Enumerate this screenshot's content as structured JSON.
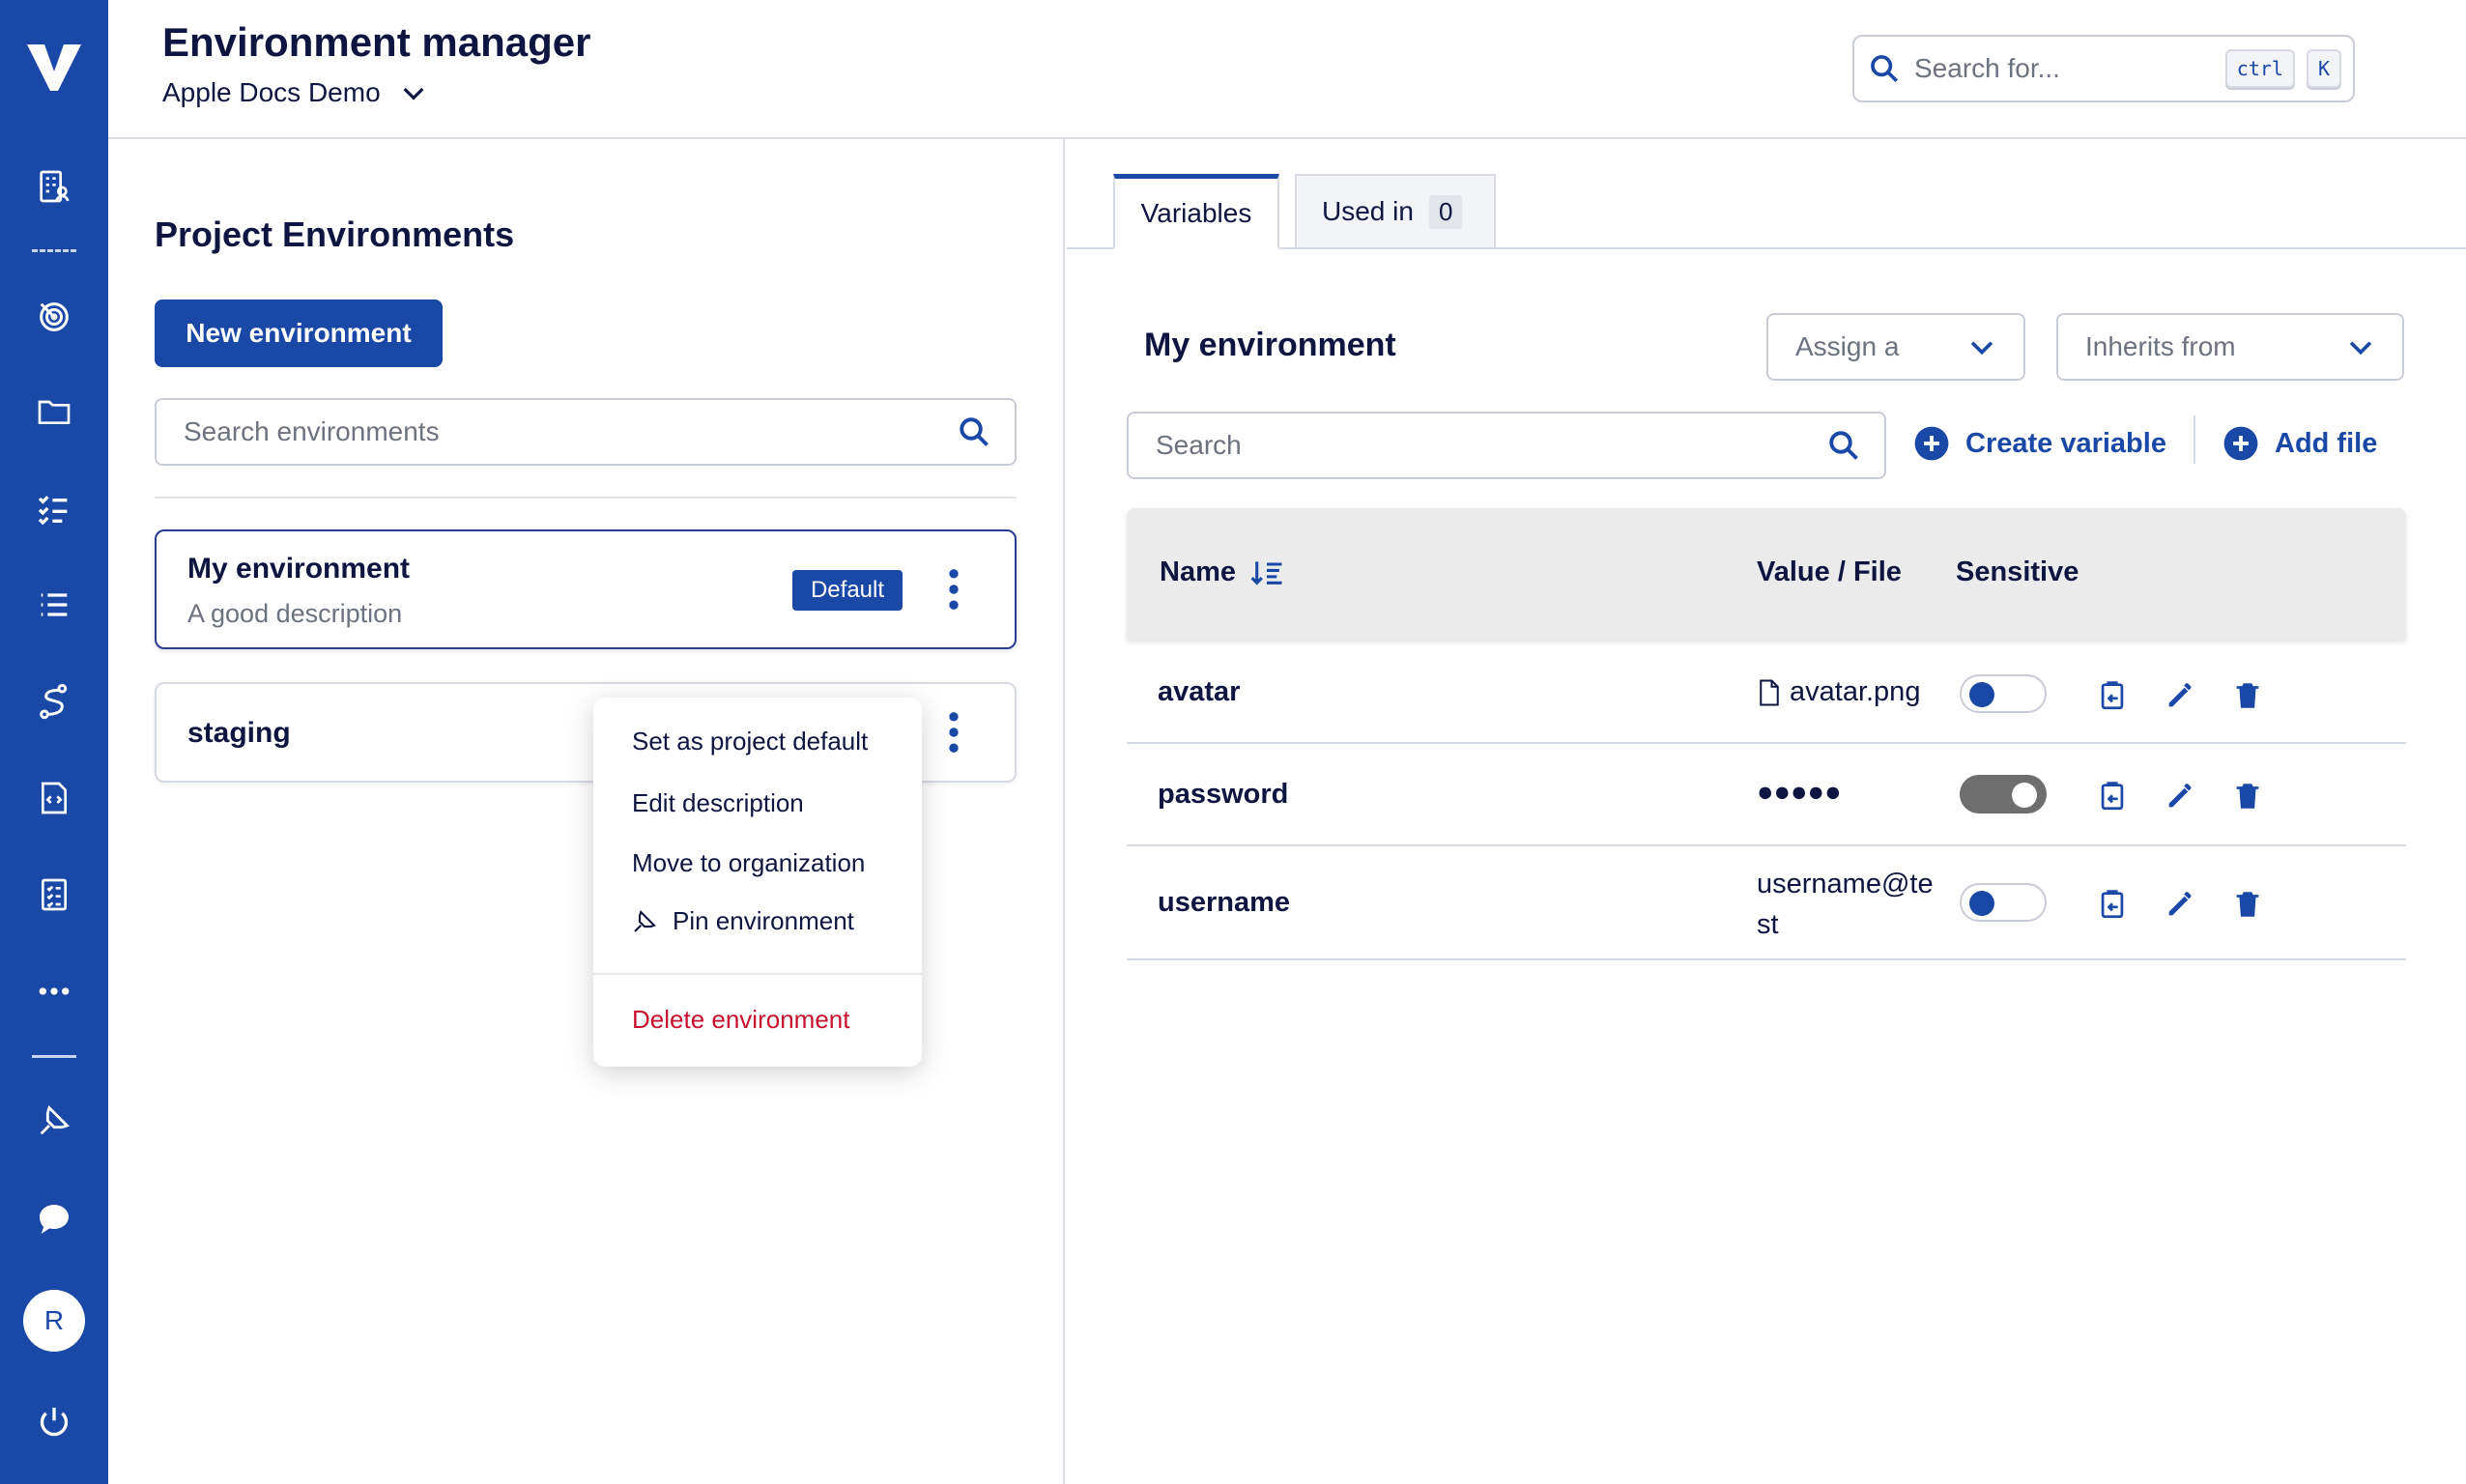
{
  "header": {
    "title": "Environment manager",
    "project_name": "Apple Docs Demo",
    "search_placeholder": "Search for...",
    "shortcut_keys": [
      "ctrl",
      "K"
    ]
  },
  "sidebar": {
    "items": [
      "logo-icon",
      "apps-icon",
      "target-icon",
      "folder-icon",
      "checklist-icon",
      "list-icon",
      "route-icon",
      "code-file-icon",
      "test-list-icon",
      "more-icon",
      "pin-icon",
      "chat-icon",
      "power-icon"
    ],
    "avatar_initial": "R",
    "accent": "#1a48a6"
  },
  "left_panel": {
    "title": "Project Environments",
    "new_button": "New environment",
    "search_placeholder": "Search environments",
    "environments": [
      {
        "name": "My environment",
        "description": "A good description",
        "badge": "Default",
        "selected": true
      },
      {
        "name": "staging",
        "description": "",
        "badge": "",
        "selected": false
      }
    ]
  },
  "context_menu": {
    "items": [
      "Set as project default",
      "Edit description",
      "Move to organization",
      "Pin environment"
    ],
    "danger_item": "Delete environment",
    "danger_color": "#c8102e"
  },
  "right_panel": {
    "tabs": [
      {
        "label": "Variables",
        "active": true
      },
      {
        "label": "Used in",
        "count": "0",
        "active": false
      }
    ],
    "environment_title": "My environment",
    "assign_placeholder": "Assign a",
    "inherits_placeholder": "Inherits from",
    "search_placeholder": "Search",
    "create_variable": "Create variable",
    "add_file": "Add file",
    "columns": [
      "Name",
      "Value / File",
      "Sensitive"
    ],
    "variables": [
      {
        "name": "avatar",
        "value": "avatar.png",
        "type": "file",
        "sensitive": false
      },
      {
        "name": "password",
        "value": "●●●●●",
        "type": "masked",
        "sensitive": true
      },
      {
        "name": "username",
        "value": "username@test",
        "type": "text",
        "sensitive": false
      }
    ]
  }
}
